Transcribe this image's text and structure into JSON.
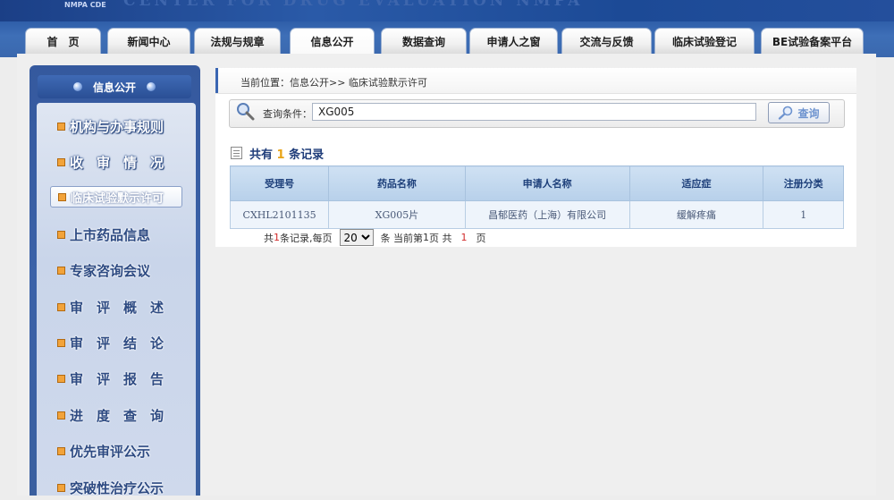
{
  "banner": {
    "logo_text": "NMPA CDE",
    "title": "CENTER FOR DRUG EVALUATION NMPA"
  },
  "nav": {
    "tabs": [
      {
        "label": "首　页"
      },
      {
        "label": "新闻中心"
      },
      {
        "label": "法规与规章"
      },
      {
        "label": "信息公开",
        "active": true
      },
      {
        "label": "数据查询"
      },
      {
        "label": "申请人之窗"
      },
      {
        "label": "交流与反馈"
      },
      {
        "label": "临床试验登记"
      },
      {
        "label": "BE试验备案平台"
      }
    ]
  },
  "sidebar": {
    "header": "信息公开",
    "items": [
      {
        "label": "机构与办事规则"
      },
      {
        "label": "收　审　情　况"
      },
      {
        "label": "临床试验默示许可",
        "active": true
      },
      {
        "label": "上市药品信息"
      },
      {
        "label": "专家咨询会议"
      },
      {
        "label": "审　评　概　述"
      },
      {
        "label": "审　评　结　论"
      },
      {
        "label": "审　评　报　告"
      },
      {
        "label": "进　度　查　询"
      },
      {
        "label": "优先审评公示"
      },
      {
        "label": "突破性治疗公示"
      }
    ]
  },
  "breadcrumb": "当前位置：信息公开>> 临床试验默示许可",
  "search": {
    "label": "查询条件：",
    "value": "XG005",
    "button_label": "查询"
  },
  "results": {
    "count_prefix": "共有",
    "count": "1",
    "count_suffix": "条记录",
    "columns": [
      "受理号",
      "药品名称",
      "申请人名称",
      "适应症",
      "注册分类"
    ],
    "rows": [
      [
        "CXHL2101135",
        "XG005片",
        "昌郁医药（上海）有限公司",
        "缓解疼痛",
        "1"
      ]
    ]
  },
  "pager": {
    "total_prefix": "共",
    "total": "1",
    "per_page_text": "条记录,每页",
    "page_size": "20",
    "page_size_options": [
      "20"
    ],
    "current_prefix": "条 当前第",
    "current": "1",
    "current_suffix": "页 共",
    "pages": "1",
    "pages_suffix": "页"
  },
  "colors": {
    "nav_blue": "#3a68ae",
    "sidebar_blue": "#3b62a8",
    "table_header": "#b7d0ea",
    "count_num": "#e8a417",
    "pager_red": "#d22a2a"
  }
}
